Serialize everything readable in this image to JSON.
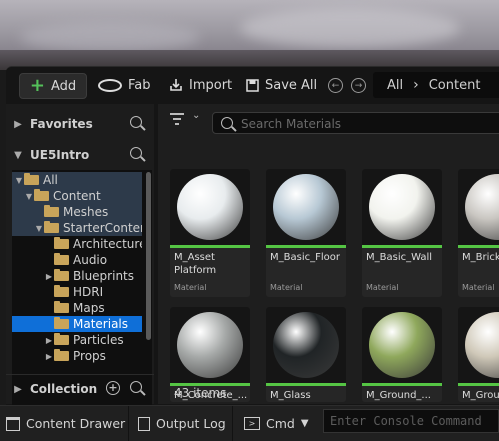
{
  "toolbar": {
    "add": "Add",
    "fab": "Fab",
    "import": "Import",
    "save_all": "Save All",
    "breadcrumb": [
      "All",
      "Content"
    ]
  },
  "left": {
    "favorites": "Favorites",
    "project": "UE5Intro",
    "collection": "Collection",
    "tree": [
      {
        "label": "All",
        "expanded": true
      },
      {
        "label": "Content",
        "expanded": true
      },
      {
        "label": "Meshes"
      },
      {
        "label": "StarterContent",
        "expanded": true
      },
      {
        "label": "Architecture"
      },
      {
        "label": "Audio"
      },
      {
        "label": "Blueprints"
      },
      {
        "label": "HDRI"
      },
      {
        "label": "Maps"
      },
      {
        "label": "Materials",
        "selected": true
      },
      {
        "label": "Particles"
      },
      {
        "label": "Props"
      }
    ]
  },
  "right": {
    "search_placeholder": "Search Materials",
    "assets": [
      {
        "name": "M_Asset Platform",
        "type": "Material",
        "color": "#e8ecee"
      },
      {
        "name": "M_Basic_Floor",
        "type": "Material",
        "color": "#b7c8d4"
      },
      {
        "name": "M_Basic_Wall",
        "type": "Material",
        "color": "#f2f3ee"
      },
      {
        "name": "M_Brick_Clay_Beveled",
        "type": "Material",
        "color": "#c9c6c1"
      },
      {
        "name": "M_Concrete_...",
        "type": "",
        "color": "#a6a9a8"
      },
      {
        "name": "M_Glass",
        "type": "",
        "color": "#202426"
      },
      {
        "name": "M_Ground_...",
        "type": "",
        "color": "#8fa85c"
      },
      {
        "name": "M_Ground...",
        "type": "",
        "color": "#cfc8b8"
      }
    ],
    "item_count": "43 items"
  },
  "statusbar": {
    "content_drawer": "Content Drawer",
    "output_log": "Output Log",
    "cmd": "Cmd",
    "console_placeholder": "Enter Console Command"
  },
  "colors": {
    "selection": "#0f6fd8",
    "material_bar": "#55c544",
    "folder": "#c8a45a"
  }
}
